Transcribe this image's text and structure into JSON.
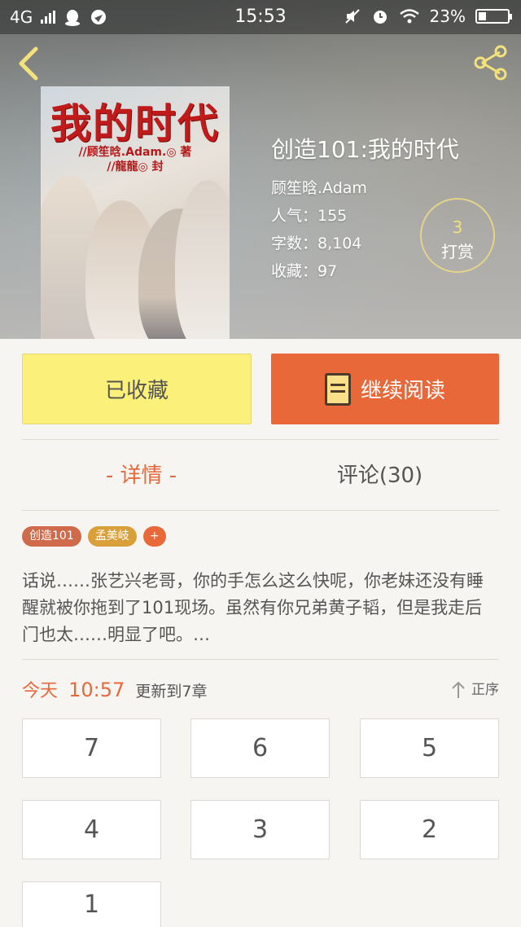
{
  "status_bar": {
    "network": "4G",
    "time": "15:53",
    "battery": "23%"
  },
  "book": {
    "cover_title": "我的时代",
    "cover_author_line": "//顾笙晗.Adam.◎ 著",
    "cover_artist_line": "//龍龍◎ 封",
    "title": "创造101:我的时代",
    "author": "顾笙晗.Adam",
    "popularity": "人气：155",
    "word_count": "字数：8,104",
    "favorites": "收藏：97"
  },
  "tip": {
    "count": "3",
    "label": "打赏"
  },
  "actions": {
    "favorited_label": "已收藏",
    "continue_label": "继续阅读"
  },
  "tabs": {
    "detail": "- 详情 -",
    "comments": "评论(30)"
  },
  "tags": [
    "创造101",
    "孟美岐",
    "+"
  ],
  "description": "话说……张艺兴老哥，你的手怎么这么快呢，你老妹还没有睡醒就被你拖到了101现场。虽然有你兄弟黄子韬，但是我走后门也太……明显了吧。…",
  "update": {
    "day": "今天",
    "time": "10:57",
    "text": "更新到7章",
    "sort_label": "正序"
  },
  "chapters": [
    "7",
    "6",
    "5",
    "4",
    "3",
    "2",
    "1"
  ],
  "colors": {
    "accent": "#e8683a",
    "favorite_bg": "#fbf07a"
  }
}
